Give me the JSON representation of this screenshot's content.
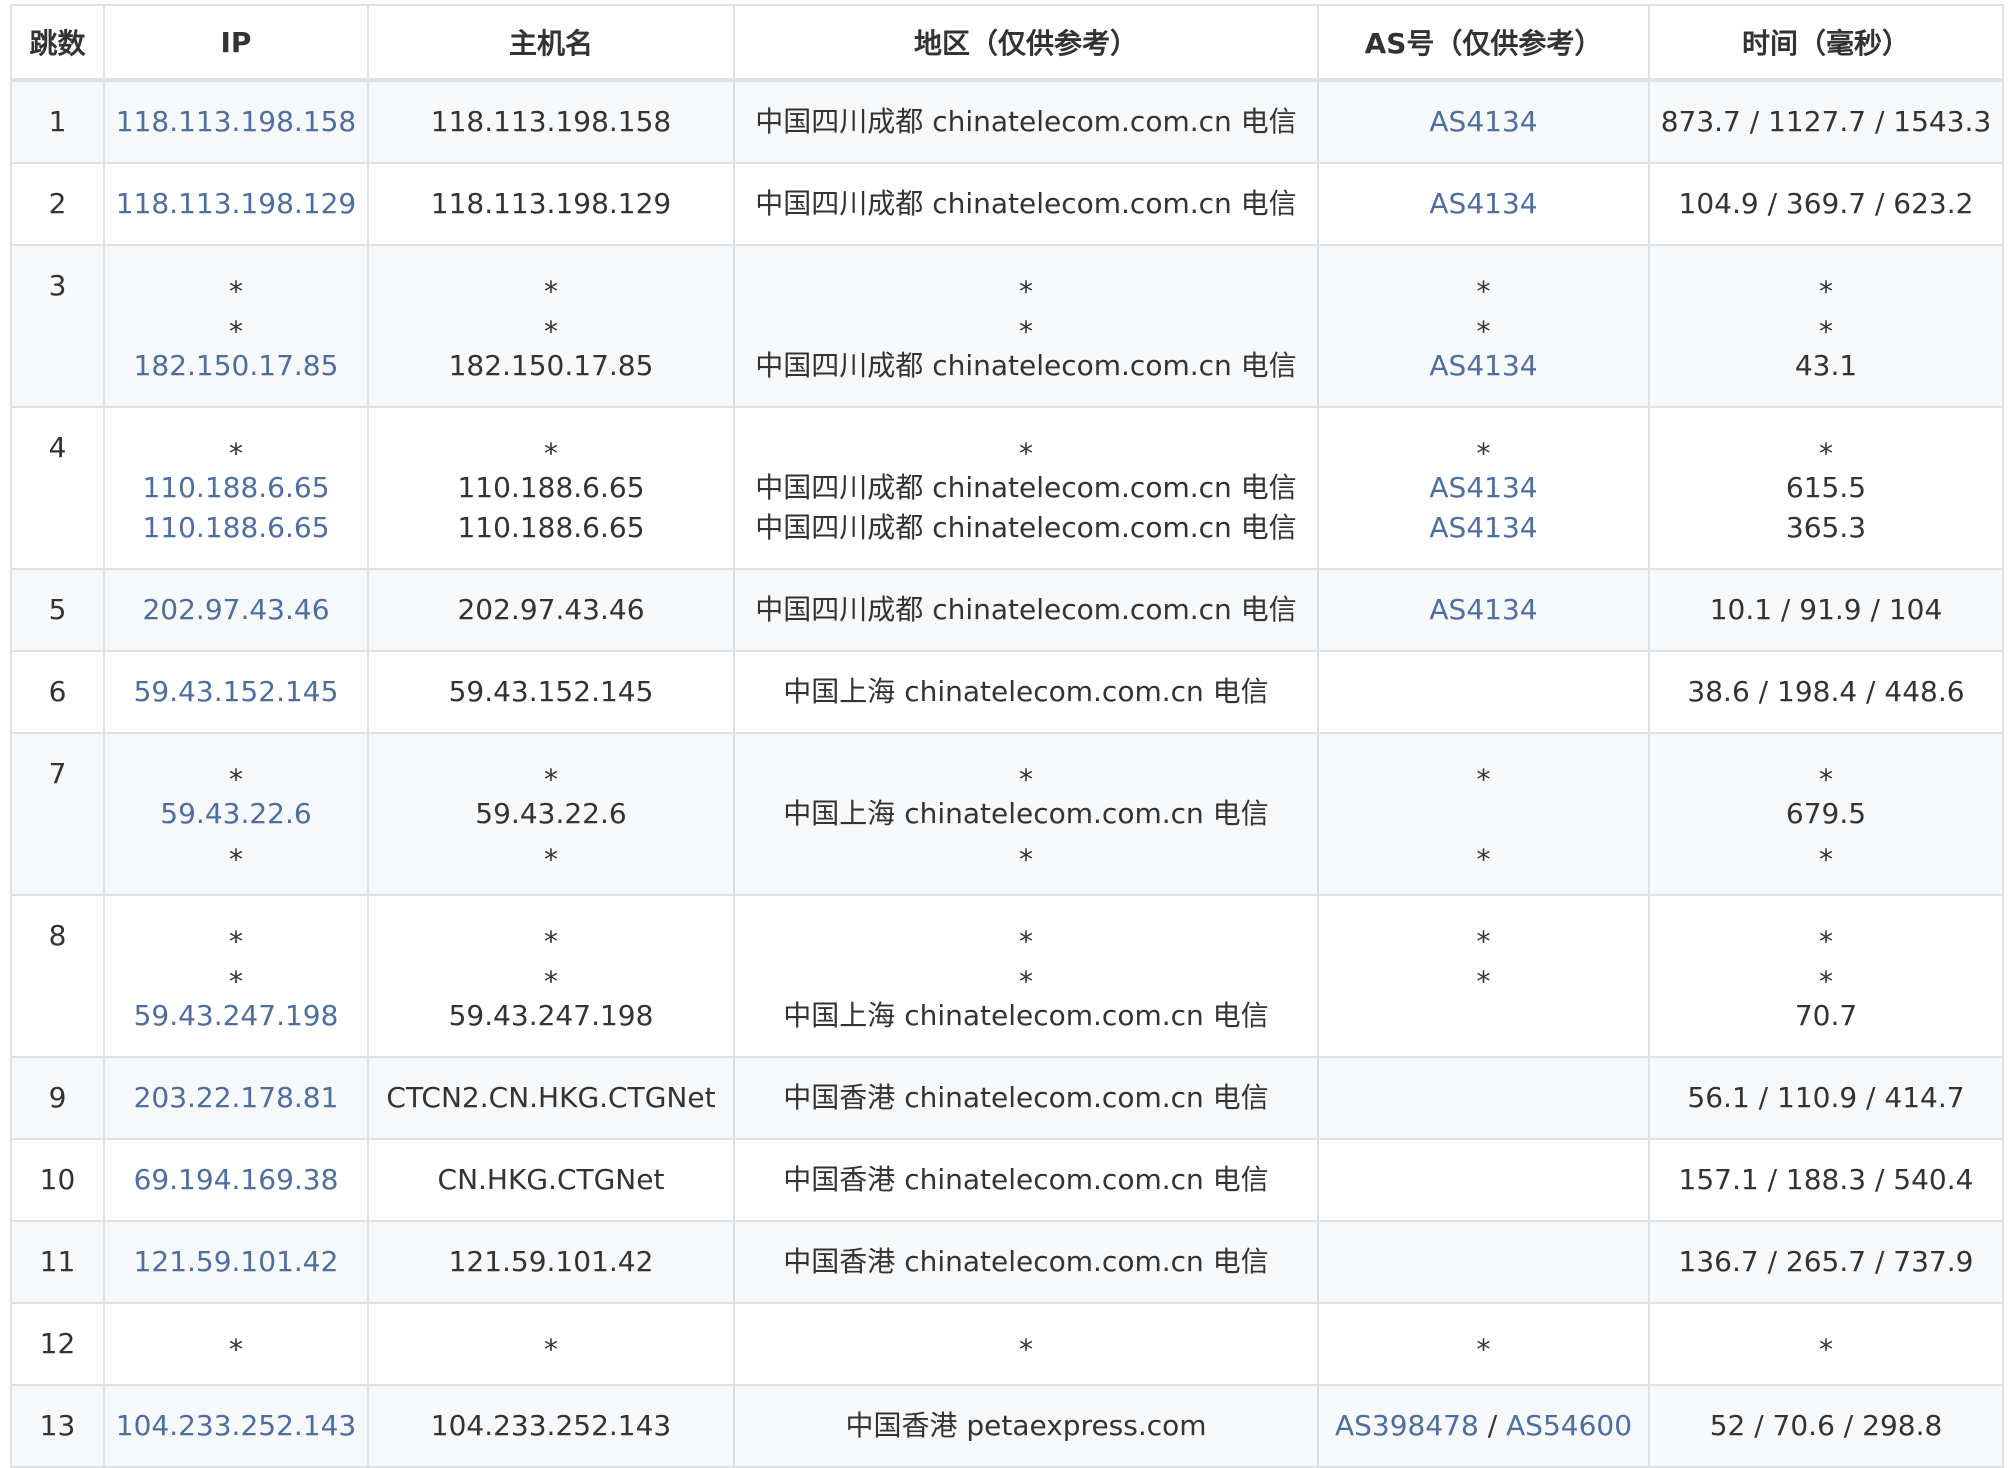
{
  "colors": {
    "link": "#4e6e9e",
    "text": "#333333",
    "stripe": "#f6f8fa",
    "border": "#dfe2e5"
  },
  "columns": [
    "跳数",
    "IP",
    "主机名",
    "地区（仅供参考）",
    "AS号（仅供参考）",
    "时间（毫秒）"
  ],
  "hops": [
    {
      "hop": "1",
      "lines": [
        {
          "ip": "118.113.198.158",
          "host": "118.113.198.158",
          "region": "中国四川成都 chinatelecom.com.cn 电信",
          "as": [
            "AS4134"
          ],
          "time": "873.7 / 1127.7 / 1543.3"
        }
      ]
    },
    {
      "hop": "2",
      "lines": [
        {
          "ip": "118.113.198.129",
          "host": "118.113.198.129",
          "region": "中国四川成都 chinatelecom.com.cn 电信",
          "as": [
            "AS4134"
          ],
          "time": "104.9 / 369.7 / 623.2"
        }
      ]
    },
    {
      "hop": "3",
      "lines": [
        {
          "ip": "*",
          "host": "*",
          "region": "*",
          "as": "*",
          "time": "*"
        },
        {
          "ip": "*",
          "host": "*",
          "region": "*",
          "as": "*",
          "time": "*"
        },
        {
          "ip": "182.150.17.85",
          "host": "182.150.17.85",
          "region": "中国四川成都 chinatelecom.com.cn 电信",
          "as": [
            "AS4134"
          ],
          "time": "43.1"
        }
      ]
    },
    {
      "hop": "4",
      "lines": [
        {
          "ip": "*",
          "host": "*",
          "region": "*",
          "as": "*",
          "time": "*"
        },
        {
          "ip": "110.188.6.65",
          "host": "110.188.6.65",
          "region": "中国四川成都 chinatelecom.com.cn 电信",
          "as": [
            "AS4134"
          ],
          "time": "615.5"
        },
        {
          "ip": "110.188.6.65",
          "host": "110.188.6.65",
          "region": "中国四川成都 chinatelecom.com.cn 电信",
          "as": [
            "AS4134"
          ],
          "time": "365.3"
        }
      ]
    },
    {
      "hop": "5",
      "lines": [
        {
          "ip": "202.97.43.46",
          "host": "202.97.43.46",
          "region": "中国四川成都 chinatelecom.com.cn 电信",
          "as": [
            "AS4134"
          ],
          "time": "10.1 / 91.9 / 104"
        }
      ]
    },
    {
      "hop": "6",
      "lines": [
        {
          "ip": "59.43.152.145",
          "host": "59.43.152.145",
          "region": "中国上海 chinatelecom.com.cn 电信",
          "as": "",
          "time": "38.6 / 198.4 / 448.6"
        }
      ]
    },
    {
      "hop": "7",
      "lines": [
        {
          "ip": "*",
          "host": "*",
          "region": "*",
          "as": "*",
          "time": "*"
        },
        {
          "ip": "59.43.22.6",
          "host": "59.43.22.6",
          "region": "中国上海 chinatelecom.com.cn 电信",
          "as": "",
          "time": "679.5"
        },
        {
          "ip": "*",
          "host": "*",
          "region": "*",
          "as": "*",
          "time": "*"
        }
      ]
    },
    {
      "hop": "8",
      "lines": [
        {
          "ip": "*",
          "host": "*",
          "region": "*",
          "as": "*",
          "time": "*"
        },
        {
          "ip": "*",
          "host": "*",
          "region": "*",
          "as": "*",
          "time": "*"
        },
        {
          "ip": "59.43.247.198",
          "host": "59.43.247.198",
          "region": "中国上海 chinatelecom.com.cn 电信",
          "as": "",
          "time": "70.7"
        }
      ]
    },
    {
      "hop": "9",
      "lines": [
        {
          "ip": "203.22.178.81",
          "host": "CTCN2.CN.HKG.CTGNet",
          "region": "中国香港 chinatelecom.com.cn 电信",
          "as": "",
          "time": "56.1 / 110.9 / 414.7"
        }
      ]
    },
    {
      "hop": "10",
      "lines": [
        {
          "ip": "69.194.169.38",
          "host": "CN.HKG.CTGNet",
          "region": "中国香港 chinatelecom.com.cn 电信",
          "as": "",
          "time": "157.1 / 188.3 / 540.4"
        }
      ]
    },
    {
      "hop": "11",
      "lines": [
        {
          "ip": "121.59.101.42",
          "host": "121.59.101.42",
          "region": "中国香港 chinatelecom.com.cn 电信",
          "as": "",
          "time": "136.7 / 265.7 / 737.9"
        }
      ]
    },
    {
      "hop": "12",
      "lines": [
        {
          "ip": "*",
          "host": "*",
          "region": "*",
          "as": "*",
          "time": "*"
        }
      ]
    },
    {
      "hop": "13",
      "lines": [
        {
          "ip": "104.233.252.143",
          "host": "104.233.252.143",
          "region": "中国香港 petaexpress.com",
          "as": [
            "AS398478",
            "AS54600"
          ],
          "time": "52 / 70.6 / 298.8"
        }
      ]
    }
  ]
}
